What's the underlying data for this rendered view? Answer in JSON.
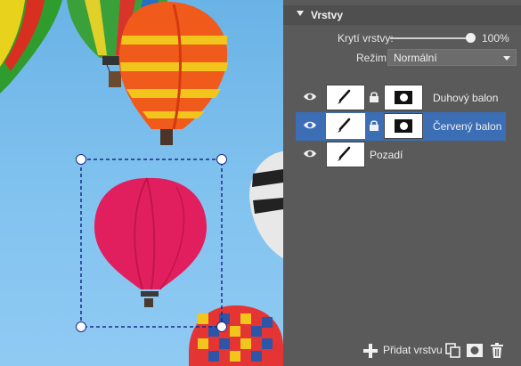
{
  "panel": {
    "title": "Vrstvy",
    "opacity_label": "Krytí vrstvy:",
    "opacity_value": "100%",
    "opacity_fraction": 1.0,
    "mode_label": "Režim:",
    "mode_value": "Normální"
  },
  "layers": [
    {
      "name": "Duhový balon",
      "selected": false,
      "has_mask": true,
      "locked": true
    },
    {
      "name": "Červený balon",
      "selected": true,
      "has_mask": true,
      "locked": true
    },
    {
      "name": "Pozadí",
      "selected": false,
      "has_mask": false,
      "locked": false
    }
  ],
  "footer": {
    "add_layer_label": "Přidat vrstvu",
    "icons": [
      "plus-icon",
      "duplicate-icon",
      "mask-icon",
      "trash-icon"
    ]
  },
  "colors": {
    "panel_bg": "#5a5a5a",
    "selected_row": "#3b6eb5",
    "sky": "#84c4f0"
  }
}
